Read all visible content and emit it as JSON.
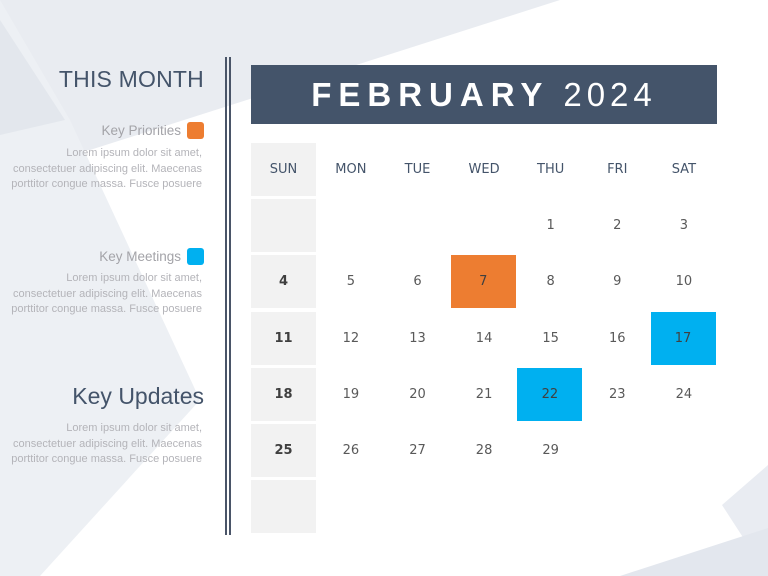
{
  "sidebar": {
    "title": "THIS MONTH",
    "legends": [
      {
        "label": "Key Priorities",
        "color": "#ed7d31",
        "text": "Lorem ipsum dolor sit amet, consectetuer adipiscing elit. Maecenas porttitor congue massa. Fusce posuere"
      },
      {
        "label": "Key Meetings",
        "color": "#00b0f0",
        "text": "Lorem ipsum dolor sit amet, consectetuer adipiscing elit. Maecenas porttitor congue massa. Fusce posuere"
      }
    ],
    "updates": {
      "title": "Key Updates",
      "text": "Lorem ipsum dolor sit amet, consectetuer adipiscing elit. Maecenas porttitor congue massa. Fusce posuere"
    }
  },
  "calendar": {
    "month": "FEBRUARY",
    "year": "2024",
    "header_color": "#44546a",
    "weekdays": [
      "SUN",
      "MON",
      "TUE",
      "WED",
      "THU",
      "FRI",
      "SAT"
    ],
    "weeks": [
      [
        "",
        "",
        "",
        "",
        "1",
        "2",
        "3"
      ],
      [
        "4",
        "5",
        "6",
        "7",
        "8",
        "9",
        "10"
      ],
      [
        "11",
        "12",
        "13",
        "14",
        "15",
        "16",
        "17"
      ],
      [
        "18",
        "19",
        "20",
        "21",
        "22",
        "23",
        "24"
      ],
      [
        "25",
        "26",
        "27",
        "28",
        "29",
        "",
        ""
      ],
      [
        "",
        "",
        "",
        "",
        "",
        "",
        ""
      ]
    ],
    "highlights": [
      {
        "day": "7",
        "type": "Key Priorities",
        "color": "#ed7d31"
      },
      {
        "day": "17",
        "type": "Key Meetings",
        "color": "#00b0f0"
      },
      {
        "day": "22",
        "type": "Key Meetings",
        "color": "#00b0f0"
      }
    ]
  }
}
